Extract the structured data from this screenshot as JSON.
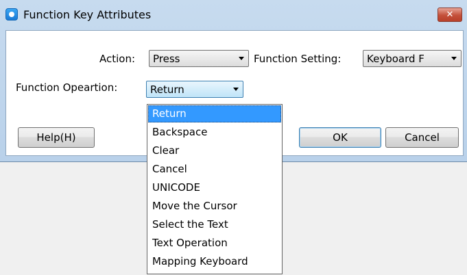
{
  "window": {
    "title": "Function Key Attributes",
    "close_label": "✕"
  },
  "form": {
    "action_label": "Action:",
    "action_value": "Press",
    "function_setting_label": "Function Setting:",
    "function_setting_value": "Keyboard F",
    "function_operation_label": "Function Opeartion:",
    "function_operation_value": "Return"
  },
  "buttons": {
    "help": "Help(H)",
    "ok": "OK",
    "cancel": "Cancel"
  },
  "dropdown": {
    "selected_index": 0,
    "options": [
      "Return",
      "Backspace",
      "Clear",
      "Cancel",
      "UNICODE",
      "Move the Cursor",
      "Select the Text",
      "Text Operation",
      "Mapping Keyboard"
    ]
  }
}
